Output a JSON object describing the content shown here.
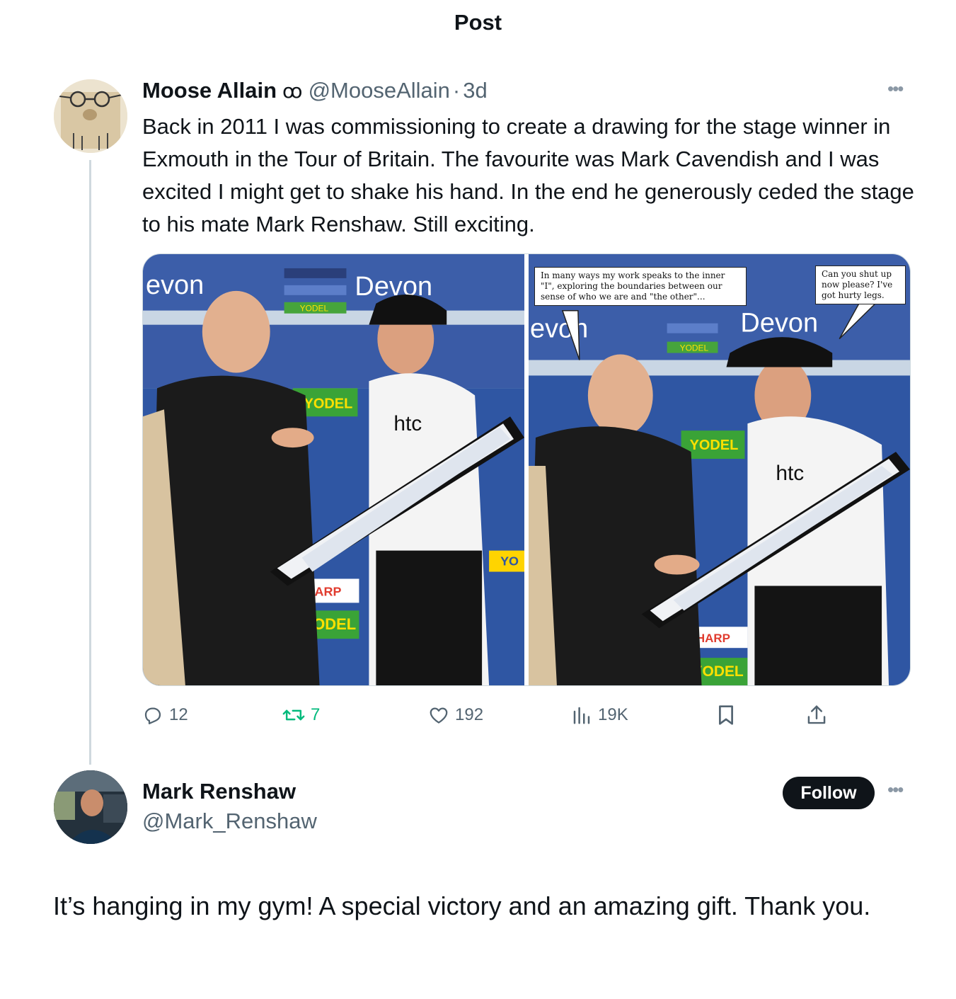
{
  "header": {
    "title": "Post"
  },
  "post": {
    "author_name": "Moose Allain",
    "author_badge": "ꝏ",
    "author_handle": "@MooseAllain",
    "separator": "·",
    "time": "3d",
    "more_icon": "more-horizontal-icon",
    "text": "Back in 2011 I was commissioning to create a drawing for the stage winner in Exmouth in the Tour of Britain. The favourite was Mark Cavendish and I was excited I might get to shake his hand. In the end he generously ceded the stage to his mate Mark Renshaw. Still exciting.",
    "media": {
      "bubble_left": "In many ways my work speaks to the inner \"I\", exploring the boundaries between our sense of who we are and \"the other\"...",
      "bubble_right": "Can you shut up now please? I've got hurty legs."
    },
    "actions": {
      "reply": {
        "icon": "reply-icon",
        "count": "12"
      },
      "repost": {
        "icon": "repost-icon",
        "count": "7",
        "color": "#00ba7c"
      },
      "like": {
        "icon": "heart-icon",
        "count": "192"
      },
      "views": {
        "icon": "views-chart-icon",
        "count": "19K"
      },
      "bookmark": {
        "icon": "bookmark-icon"
      },
      "share": {
        "icon": "share-icon"
      }
    }
  },
  "reply": {
    "author_name": "Mark Renshaw",
    "author_handle": "@Mark_Renshaw",
    "follow_label": "Follow",
    "text": "It’s hanging in my gym! A special victory and an amazing gift. Thank you."
  },
  "colors": {
    "text_primary": "#0f1419",
    "text_secondary": "#536471",
    "repost_green": "#00ba7c",
    "thread_line": "#cfd9de",
    "follow_bg": "#0f1419"
  }
}
